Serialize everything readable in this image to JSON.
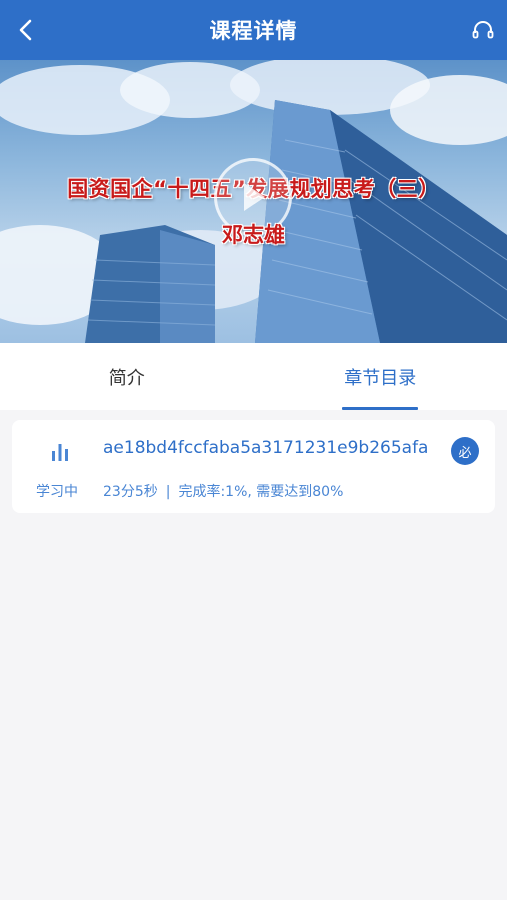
{
  "header": {
    "title": "课程详情",
    "back_icon": "chevron-left-icon",
    "service_icon": "headset-icon"
  },
  "banner": {
    "headline": "国资国企“十四五”发展规划思考（三）",
    "speaker": "邓志雄",
    "play_icon": "play-icon"
  },
  "tabs": [
    {
      "label": "简介",
      "active": false
    },
    {
      "label": "章节目录",
      "active": true
    }
  ],
  "chapter": {
    "status_icon": "bar-chart-icon",
    "title": "ae18bd4fccfaba5a3171231e9b265afa",
    "required_badge": "必",
    "status": "学习中",
    "duration": "23分5秒",
    "separator": "|",
    "progress": "完成率:1%, 需要达到80%"
  },
  "colors": {
    "primary": "#2e6fc8",
    "headline_red": "#c81a1a",
    "background": "#f5f5f7"
  }
}
